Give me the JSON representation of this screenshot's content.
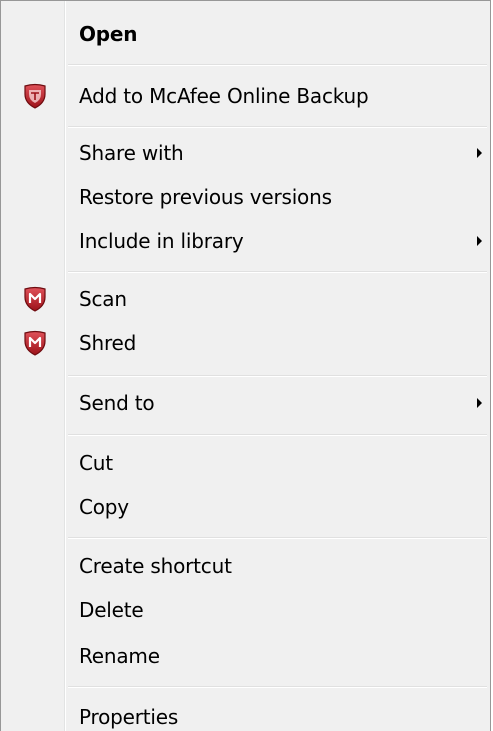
{
  "menu": {
    "items": [
      {
        "label": "Open"
      },
      {
        "label": "Add to McAfee Online Backup",
        "icon": "mcafee-shield-icon"
      },
      {
        "label": "Share with"
      },
      {
        "label": "Restore previous versions"
      },
      {
        "label": "Include in library"
      },
      {
        "label": "Scan",
        "icon": "mcafee-shield-icon"
      },
      {
        "label": "Shred",
        "icon": "mcafee-shield-icon"
      },
      {
        "label": "Send to"
      },
      {
        "label": "Cut"
      },
      {
        "label": "Copy"
      },
      {
        "label": "Create shortcut"
      },
      {
        "label": "Delete"
      },
      {
        "label": "Rename"
      },
      {
        "label": "Properties"
      }
    ],
    "colors": {
      "background": "#f0f0f0",
      "border": "#979797",
      "icon_red": "#c0222a"
    }
  }
}
